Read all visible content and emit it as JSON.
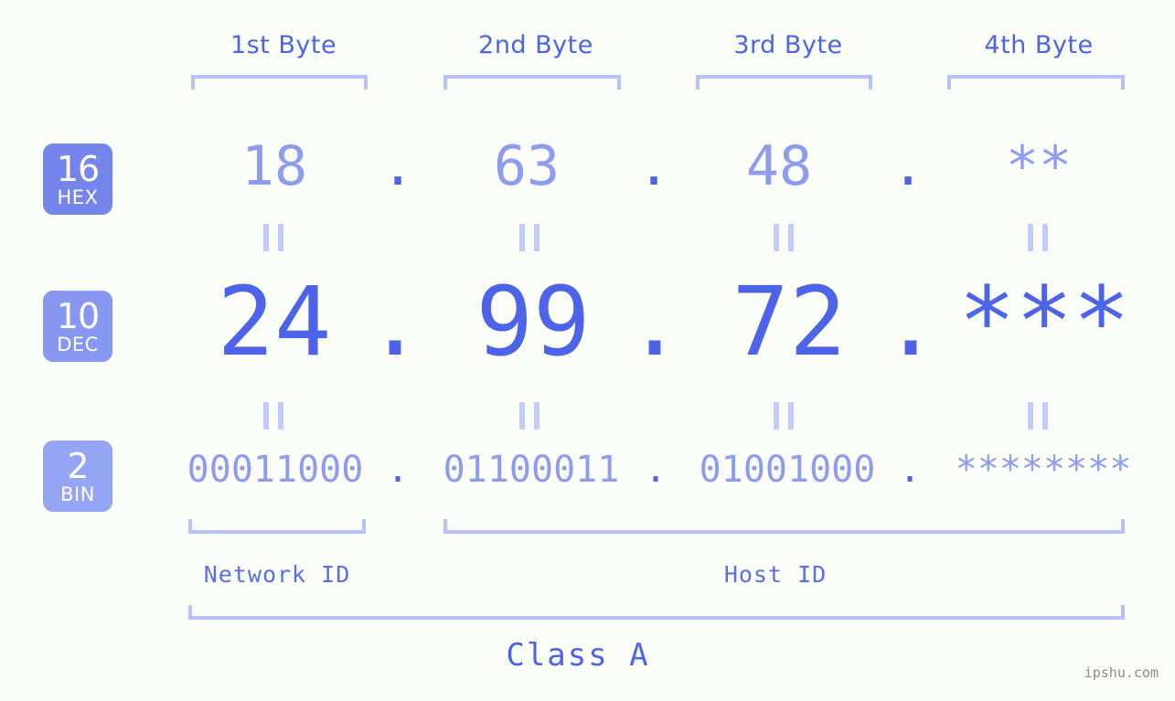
{
  "background_color": "#fbfdf8",
  "accent_color": "#4d63e8",
  "accent_light_color": "#8e9cf0",
  "bracket_color": "#b8c2f7",
  "headers": [
    {
      "label": "1st Byte"
    },
    {
      "label": "2nd Byte"
    },
    {
      "label": "3rd Byte"
    },
    {
      "label": "4th Byte"
    }
  ],
  "rows": [
    {
      "base_number": "16",
      "base_name": "HEX",
      "badge_color": "#7585ec",
      "values": [
        "18",
        "63",
        "48",
        "**"
      ],
      "separator": "."
    },
    {
      "base_number": "10",
      "base_name": "DEC",
      "badge_color": "#8897ef",
      "values": [
        "24",
        "99",
        "72",
        "***"
      ],
      "separator": "."
    },
    {
      "base_number": "2",
      "base_name": "BIN",
      "badge_color": "#93a5f4",
      "values": [
        "00011000",
        "01100011",
        "01001000",
        "********"
      ],
      "separator": "."
    }
  ],
  "equals_glyph": "||",
  "id_labels": {
    "network": "Network ID",
    "host": "Host ID"
  },
  "class_label": "Class A",
  "watermark": "ipshu.com"
}
